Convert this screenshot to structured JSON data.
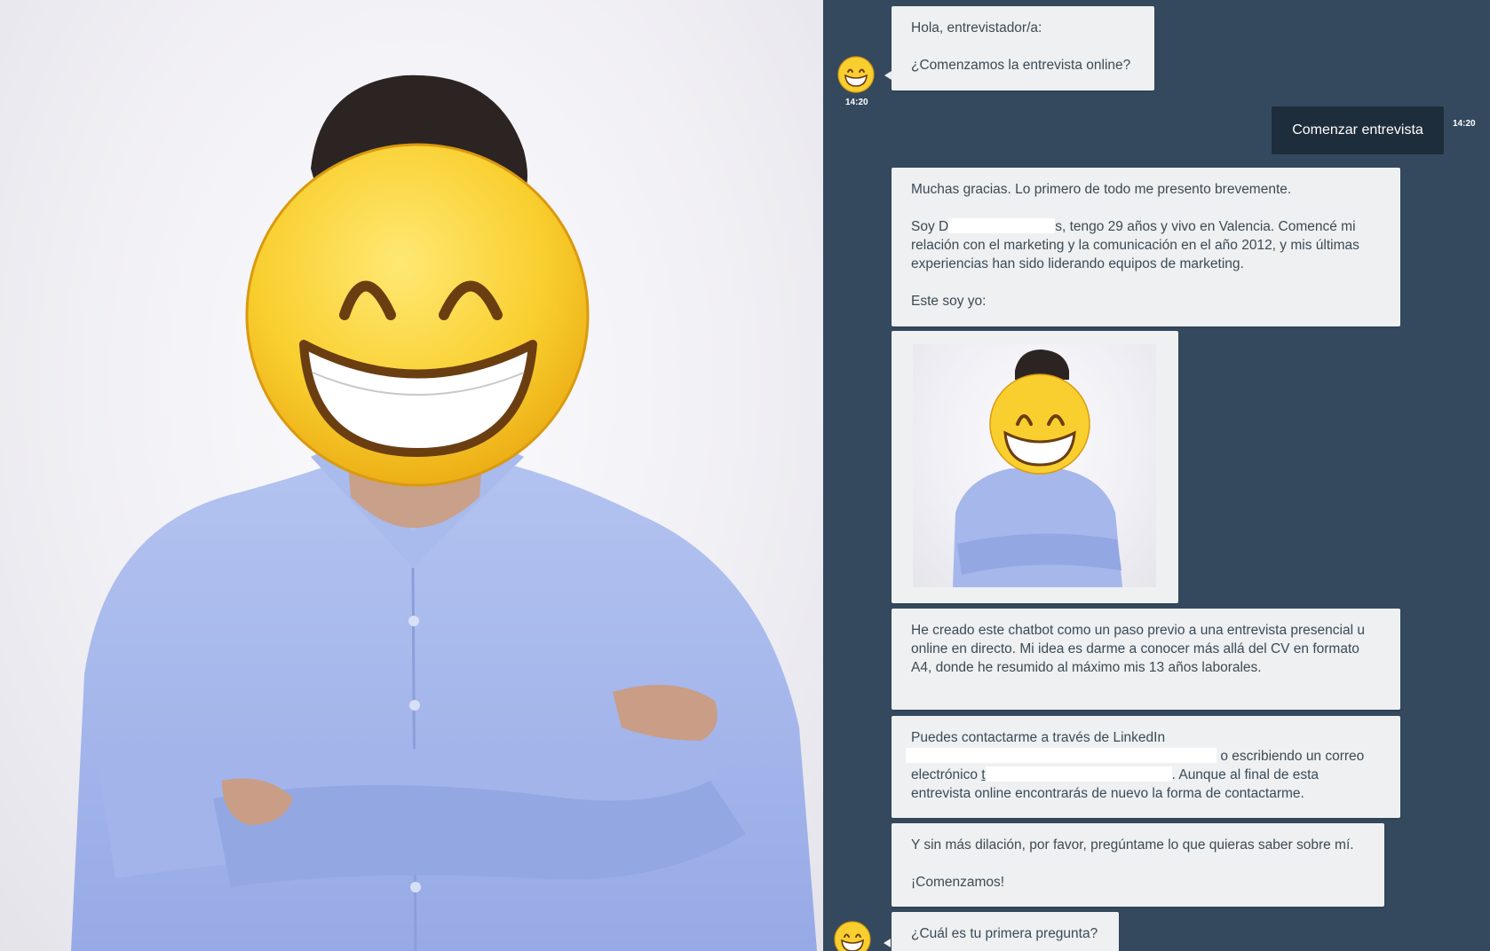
{
  "left_image": {
    "alt": ""
  },
  "chat": {
    "bot_avatar_icon": "grinning-face-icon",
    "messages": [
      {
        "id": "m1",
        "from": "bot",
        "paragraphs": [
          "Hola, entrevistador/a:",
          "¿Comenzamos la entrevista online?"
        ],
        "time": "14:20"
      },
      {
        "id": "m2",
        "from": "user",
        "text": "Comenzar entrevista",
        "time": "14:20"
      },
      {
        "id": "m3",
        "from": "bot",
        "p1": "Muchas gracias. Lo primero de todo me presento brevemente.",
        "p2a": "Soy D",
        "p2b": "s, tengo 29 años y vivo en Valencia. Comencé mi relación con el marketing y la comunicación en el año 2012, y mis últimas experiencias han sido liderando equipos de marketing.",
        "p3": "Este soy yo:"
      },
      {
        "id": "m4",
        "from": "bot",
        "type": "image"
      },
      {
        "id": "m5",
        "from": "bot",
        "text": "He creado este chatbot como un paso previo a una entrevista presencial u online en directo. Mi idea es darme a conocer más allá del CV en formato A4, donde he resumido al máximo mis 13 años laborales."
      },
      {
        "id": "m6",
        "from": "bot",
        "a": "Puedes contactarme a través de LinkedIn",
        "b": "o escribiendo un correo",
        "c": "electrónico",
        "d": "t",
        "e": ". Aunque al final de esta entrevista online encontrarás de nuevo la forma de contactarme."
      },
      {
        "id": "m7",
        "from": "bot",
        "paragraphs": [
          "Y sin más dilación, por favor, pregúntame lo que quieras saber sobre mí.",
          "¡Comenzamos!"
        ]
      },
      {
        "id": "m8",
        "from": "bot",
        "text": "¿Cuál es tu primera pregunta?"
      }
    ]
  },
  "colors": {
    "chat_background": "#34495e",
    "bot_bubble": "#eef0f1",
    "user_bubble": "#1e2d3b",
    "text": "#3c4a56"
  }
}
